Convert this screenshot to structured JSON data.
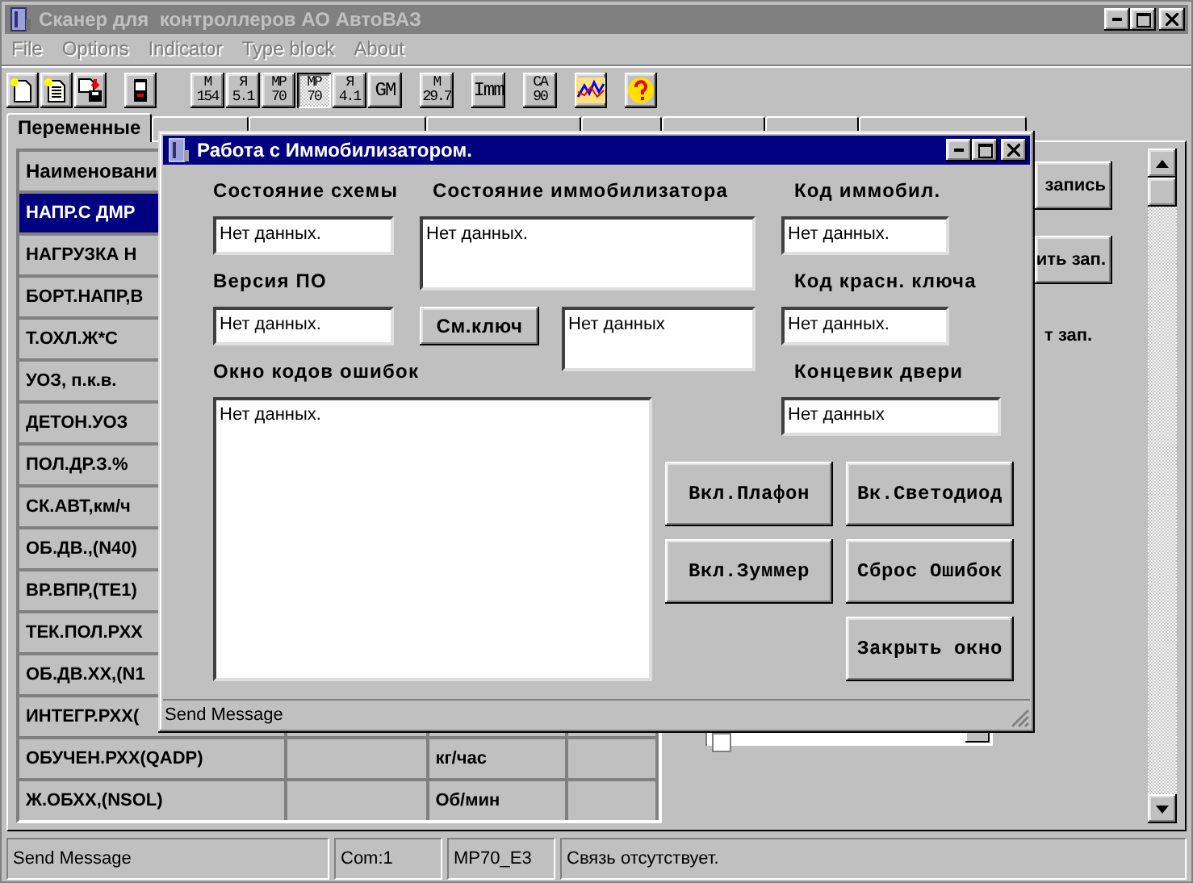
{
  "window": {
    "title": "Сканер для  контроллеров АО АвтоВАЗ"
  },
  "menu": [
    {
      "label": "File",
      "disabled": true
    },
    {
      "label": "Options",
      "disabled": true
    },
    {
      "label": "Indicator",
      "disabled": true
    },
    {
      "label": "Type block",
      "disabled": true
    },
    {
      "label": "About",
      "disabled": true
    }
  ],
  "toolbar_models": [
    {
      "lines": [
        "M",
        "154"
      ],
      "selected": false
    },
    {
      "lines": [
        "Я",
        "5.1"
      ],
      "selected": false
    },
    {
      "lines": [
        "MP",
        "70"
      ],
      "selected": false
    },
    {
      "lines": [
        "MP",
        "70"
      ],
      "selected": true
    },
    {
      "lines": [
        "Я",
        "4.1"
      ],
      "selected": false
    },
    {
      "lines": [
        "GM"
      ],
      "selected": false
    },
    {
      "lines": [
        "M",
        "29.7"
      ],
      "selected": false
    },
    {
      "lines": [
        "Imm"
      ],
      "selected": false
    },
    {
      "lines": [
        "CA",
        "90"
      ],
      "selected": false
    }
  ],
  "tabs": [
    {
      "label": "Переменные",
      "selected": true
    },
    {
      "selected": false
    },
    {
      "selected": false
    },
    {
      "selected": false
    },
    {
      "selected": false
    },
    {
      "selected": false
    },
    {
      "selected": false
    },
    {
      "selected": false
    }
  ],
  "table": {
    "columns": [
      "Наименовани"
    ],
    "rows": [
      {
        "name": "НАПР.С ДМР",
        "selected": true
      },
      {
        "name": "НАГРУЗКА Н",
        "selected": false
      },
      {
        "name": "БОРТ.НАПР,В",
        "selected": false
      },
      {
        "name": "Т.ОХЛ.Ж*С",
        "selected": false
      },
      {
        "name": "УОЗ, п.к.в.",
        "selected": false
      },
      {
        "name": "ДЕТОН.УОЗ",
        "selected": false
      },
      {
        "name": "ПОЛ.ДР.З.%",
        "selected": false
      },
      {
        "name": "СК.АВТ,км/ч",
        "selected": false
      },
      {
        "name": "ОБ.ДВ.,(N40)",
        "selected": false
      },
      {
        "name": "ВР.ВПР,(TE1)",
        "selected": false
      },
      {
        "name": "ТЕК.ПОЛ.РХХ",
        "selected": false
      },
      {
        "name": "ОБ.ДВ.ХХ,(N1",
        "selected": false
      },
      {
        "name": "ИНТЕГР.РХХ(",
        "selected": false
      },
      {
        "name": "ОБУЧЕН.РХХ(QADP)",
        "unit": "кг/час",
        "selected": false
      },
      {
        "name": "Ж.ОБХХ,(NSOL)",
        "unit": "Об/мин",
        "selected": false
      }
    ]
  },
  "side_panel": {
    "buttons": [
      "запись",
      "ить зап."
    ],
    "note": "т зап.",
    "list_item": {
      "checked": false
    }
  },
  "dialog": {
    "title": "Работа с Иммобилизатором.",
    "scheme_state": {
      "label": "Состояние схемы",
      "value": "Нет данных."
    },
    "immo_state": {
      "label": "Состояние иммобилизатора",
      "value": "Нет данных."
    },
    "immo_code": {
      "label": "Код иммобил.",
      "value": "Нет данных."
    },
    "version": {
      "label": "Версия ПО",
      "value": "Нет данных."
    },
    "key_button": "См.ключ",
    "key_value": "Нет данных",
    "red_key_code": {
      "label": "Код красн. ключа",
      "value": "Нет данных."
    },
    "error_codes": {
      "label": "Окно кодов ошибок",
      "value": "Нет данных."
    },
    "door_switch": {
      "label": "Концевик двери",
      "value": "Нет данных"
    },
    "buttons": [
      "Вкл.Плафон",
      "Вк.Светодиод",
      "Вкл.Зуммер",
      "Сброс Ошибок",
      "Закрыть окно"
    ],
    "status": "Send Message"
  },
  "status_bar": [
    "Send Message",
    "Com:1",
    "MP70_E3",
    "Связь отсутствует."
  ]
}
